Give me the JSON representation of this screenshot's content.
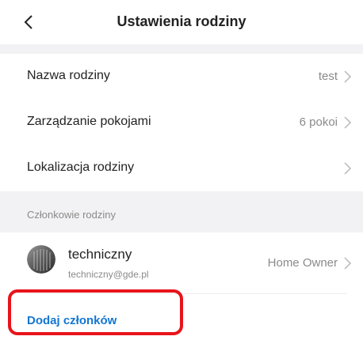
{
  "header": {
    "title": "Ustawienia rodziny",
    "back_icon": "chevron-left-icon"
  },
  "settings": [
    {
      "label": "Nazwa rodziny",
      "value": "test"
    },
    {
      "label": "Zarządzanie pokojami",
      "value": "6 pokoi"
    },
    {
      "label": "Lokalizacja rodziny",
      "value": ""
    }
  ],
  "members_section": {
    "header": "Członkowie rodziny",
    "members": [
      {
        "name": "techniczny",
        "email": "techniczny@gde.pl",
        "role": "Home Owner"
      }
    ]
  },
  "add_member": {
    "label": "Dodaj członków"
  },
  "colors": {
    "accent": "#1476d2",
    "highlight": "#e8141b",
    "background": "#f2f2f4"
  }
}
